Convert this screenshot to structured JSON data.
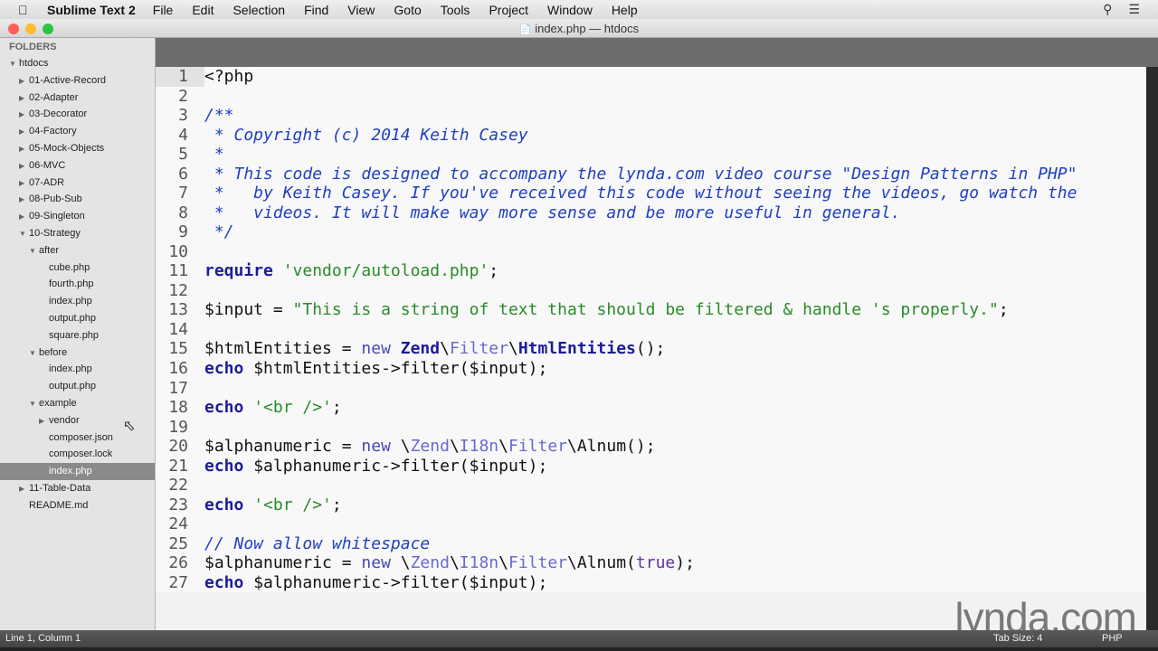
{
  "menubar": {
    "app": "Sublime Text 2",
    "items": [
      "File",
      "Edit",
      "Selection",
      "Find",
      "View",
      "Goto",
      "Tools",
      "Project",
      "Window",
      "Help"
    ]
  },
  "window": {
    "title": "index.php — htdocs"
  },
  "sidebar": {
    "header": "FOLDERS",
    "items": [
      {
        "label": "htdocs",
        "level": 0,
        "type": "open"
      },
      {
        "label": "01-Active-Record",
        "level": 1,
        "type": "closed"
      },
      {
        "label": "02-Adapter",
        "level": 1,
        "type": "closed"
      },
      {
        "label": "03-Decorator",
        "level": 1,
        "type": "closed"
      },
      {
        "label": "04-Factory",
        "level": 1,
        "type": "closed"
      },
      {
        "label": "05-Mock-Objects",
        "level": 1,
        "type": "closed"
      },
      {
        "label": "06-MVC",
        "level": 1,
        "type": "closed"
      },
      {
        "label": "07-ADR",
        "level": 1,
        "type": "closed"
      },
      {
        "label": "08-Pub-Sub",
        "level": 1,
        "type": "closed"
      },
      {
        "label": "09-Singleton",
        "level": 1,
        "type": "closed"
      },
      {
        "label": "10-Strategy",
        "level": 1,
        "type": "open"
      },
      {
        "label": "after",
        "level": 2,
        "type": "open"
      },
      {
        "label": "cube.php",
        "level": 3,
        "type": "file"
      },
      {
        "label": "fourth.php",
        "level": 3,
        "type": "file"
      },
      {
        "label": "index.php",
        "level": 3,
        "type": "file"
      },
      {
        "label": "output.php",
        "level": 3,
        "type": "file"
      },
      {
        "label": "square.php",
        "level": 3,
        "type": "file"
      },
      {
        "label": "before",
        "level": 2,
        "type": "open"
      },
      {
        "label": "index.php",
        "level": 3,
        "type": "file"
      },
      {
        "label": "output.php",
        "level": 3,
        "type": "file"
      },
      {
        "label": "example",
        "level": 2,
        "type": "open"
      },
      {
        "label": "vendor",
        "level": 3,
        "type": "closed"
      },
      {
        "label": "composer.json",
        "level": 3,
        "type": "file"
      },
      {
        "label": "composer.lock",
        "level": 3,
        "type": "file"
      },
      {
        "label": "index.php",
        "level": 3,
        "type": "file",
        "selected": true
      },
      {
        "label": "11-Table-Data",
        "level": 1,
        "type": "closed"
      },
      {
        "label": "README.md",
        "level": 1,
        "type": "file"
      }
    ]
  },
  "code": [
    [
      [
        "txt",
        "<?php"
      ]
    ],
    [],
    [
      [
        "cm",
        "/**"
      ]
    ],
    [
      [
        "cm",
        " * Copyright (c) 2014 Keith Casey"
      ]
    ],
    [
      [
        "cm",
        " *"
      ]
    ],
    [
      [
        "cm",
        " * This code is designed to accompany the lynda.com video course \"Design Patterns in PHP\""
      ]
    ],
    [
      [
        "cm",
        " *   by Keith Casey. If you've received this code without seeing the videos, go watch the"
      ]
    ],
    [
      [
        "cm",
        " *   videos. It will make way more sense and be more useful in general."
      ]
    ],
    [
      [
        "cm",
        " */"
      ]
    ],
    [],
    [
      [
        "kw",
        "require"
      ],
      [
        "txt",
        " "
      ],
      [
        "str",
        "'vendor/autoload.php'"
      ],
      [
        "txt",
        ";"
      ]
    ],
    [],
    [
      [
        "txt",
        "$input = "
      ],
      [
        "str",
        "\"This is a string of text that should be filtered & handle 's properly.\""
      ],
      [
        "txt",
        ";"
      ]
    ],
    [],
    [
      [
        "txt",
        "$htmlEntities = "
      ],
      [
        "new",
        "new "
      ],
      [
        "cls",
        "Zend"
      ],
      [
        "txt",
        "\\"
      ],
      [
        "ns",
        "Filter"
      ],
      [
        "txt",
        "\\"
      ],
      [
        "cls",
        "HtmlEntities"
      ],
      [
        "txt",
        "();"
      ]
    ],
    [
      [
        "kw",
        "echo"
      ],
      [
        "txt",
        " $htmlEntities->filter($input);"
      ]
    ],
    [],
    [
      [
        "kw",
        "echo"
      ],
      [
        "txt",
        " "
      ],
      [
        "str",
        "'<br />'"
      ],
      [
        "txt",
        ";"
      ]
    ],
    [],
    [
      [
        "txt",
        "$alphanumeric = "
      ],
      [
        "new",
        "new "
      ],
      [
        "txt",
        "\\"
      ],
      [
        "ns",
        "Zend"
      ],
      [
        "txt",
        "\\"
      ],
      [
        "ns",
        "I18n"
      ],
      [
        "txt",
        "\\"
      ],
      [
        "ns",
        "Filter"
      ],
      [
        "txt",
        "\\Alnum();"
      ]
    ],
    [
      [
        "kw",
        "echo"
      ],
      [
        "txt",
        " $alphanumeric->filter($input);"
      ]
    ],
    [],
    [
      [
        "kw",
        "echo"
      ],
      [
        "txt",
        " "
      ],
      [
        "str",
        "'<br />'"
      ],
      [
        "txt",
        ";"
      ]
    ],
    [],
    [
      [
        "cm",
        "// Now allow whitespace"
      ]
    ],
    [
      [
        "txt",
        "$alphanumeric = "
      ],
      [
        "new",
        "new "
      ],
      [
        "txt",
        "\\"
      ],
      [
        "ns",
        "Zend"
      ],
      [
        "txt",
        "\\"
      ],
      [
        "ns",
        "I18n"
      ],
      [
        "txt",
        "\\"
      ],
      [
        "ns",
        "Filter"
      ],
      [
        "txt",
        "\\Alnum("
      ],
      [
        "bool",
        "true"
      ],
      [
        "txt",
        ");"
      ]
    ],
    [
      [
        "kw",
        "echo"
      ],
      [
        "txt",
        " $alphanumeric->filter($input);"
      ]
    ]
  ],
  "status": {
    "position": "Line 1, Column 1",
    "tab_size": "Tab Size: 4",
    "syntax": "PHP"
  },
  "watermark": {
    "brand": "lynda",
    "suffix": ".com"
  }
}
